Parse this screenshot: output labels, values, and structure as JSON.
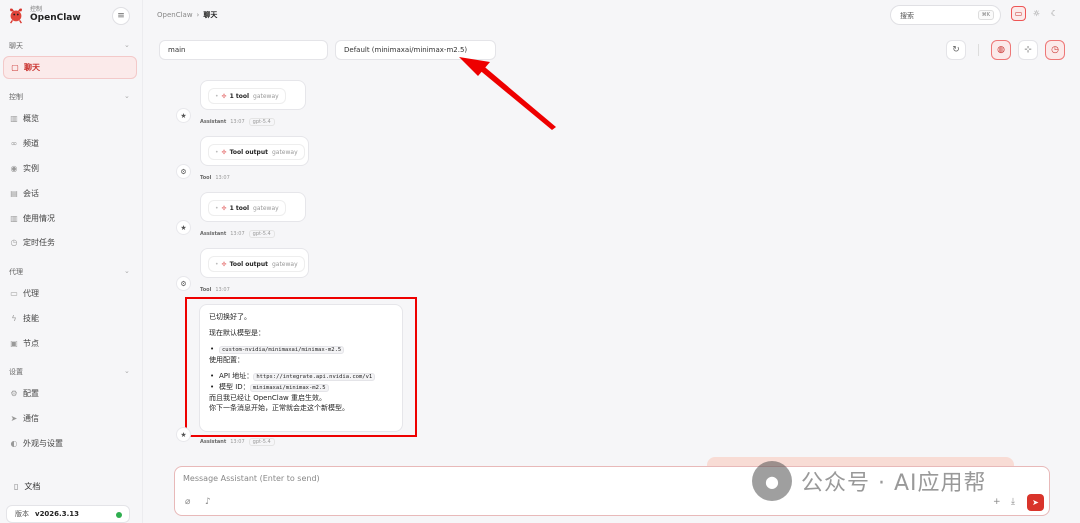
{
  "brand": {
    "subtitle": "控制",
    "name": "OpenClaw"
  },
  "sidebar": {
    "sections": [
      {
        "title": "聊天",
        "items": [
          {
            "label": "聊天",
            "icon": "chat-bubble-icon",
            "active": true
          }
        ]
      },
      {
        "title": "控制",
        "items": [
          {
            "label": "概览",
            "icon": "bar-chart-icon"
          },
          {
            "label": "频道",
            "icon": "link-icon"
          },
          {
            "label": "实例",
            "icon": "radio-icon"
          },
          {
            "label": "会话",
            "icon": "file-icon"
          },
          {
            "label": "使用情况",
            "icon": "bar-chart-icon"
          },
          {
            "label": "定时任务",
            "icon": "clock-icon"
          }
        ]
      },
      {
        "title": "代理",
        "items": [
          {
            "label": "代理",
            "icon": "folder-icon"
          },
          {
            "label": "技能",
            "icon": "bolt-icon"
          },
          {
            "label": "节点",
            "icon": "monitor-icon"
          }
        ]
      },
      {
        "title": "设置",
        "items": [
          {
            "label": "配置",
            "icon": "gear-icon"
          },
          {
            "label": "通信",
            "icon": "send-icon"
          },
          {
            "label": "外观与设置",
            "icon": "palette-icon"
          }
        ]
      }
    ],
    "docs_label": "文档",
    "version_label": "版本",
    "version_value": "v2026.3.13"
  },
  "header": {
    "breadcrumb_root": "OpenClaw",
    "breadcrumb_current": "聊天",
    "search_placeholder": "搜索",
    "search_shortcut": "⌘K"
  },
  "toolbar": {
    "session_value": "main",
    "model_value": "Default (minimaxai/minimax-m2.5)"
  },
  "messages": [
    {
      "kind": "tool_call",
      "label": "1 tool",
      "source": "gateway",
      "role": "Assistant",
      "time": "13:07",
      "model": "gpt-5.4"
    },
    {
      "kind": "tool_output",
      "label": "Tool output",
      "source": "gateway",
      "role": "Tool",
      "time": "13:07"
    },
    {
      "kind": "tool_call",
      "label": "1 tool",
      "source": "gateway",
      "role": "Assistant",
      "time": "13:07",
      "model": "gpt-5.4"
    },
    {
      "kind": "tool_output",
      "label": "Tool output",
      "source": "gateway",
      "role": "Tool",
      "time": "13:07"
    }
  ],
  "answer": {
    "line1": "已切换好了。",
    "line2": "现在默认模型是：",
    "model_code": "custom-nvidia/minimaxai/minimax-m2.5",
    "config_label": "使用配置：",
    "api_label": "API 地址：",
    "api_value": "https://integrate.api.nvidia.com/v1",
    "model_id_label": "模型 ID：",
    "model_id_value": "minimaxai/minimax-m2.5",
    "restart_note": "而且我已经让 OpenClaw 重启生效。",
    "next_note": "你下一条消息开始，正常就会走这个新模型。",
    "role": "Assistant",
    "time": "13:07",
    "model": "gpt-5.4"
  },
  "composer": {
    "placeholder": "Message Assistant (Enter to send)"
  },
  "watermark": {
    "text": "公众号 · AI应用帮"
  },
  "colors": {
    "accent": "#c9302c",
    "annotation": "#ee0000"
  }
}
